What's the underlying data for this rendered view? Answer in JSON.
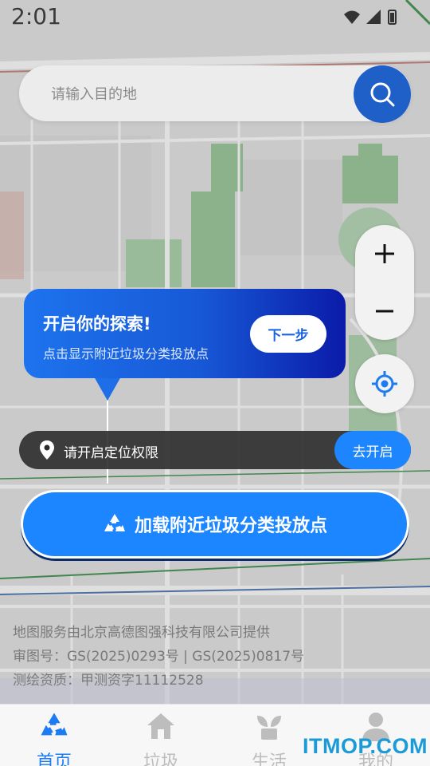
{
  "status_bar": {
    "time": "2:01"
  },
  "search": {
    "placeholder": "请输入目的地"
  },
  "guide_tooltip": {
    "title": "开启你的探索!",
    "subtitle": "点击显示附近垃圾分类投放点",
    "next_label": "下一步"
  },
  "location_banner": {
    "message": "请开启定位权限",
    "action_label": "去开启"
  },
  "main_action": {
    "label": "加载附近垃圾分类投放点"
  },
  "map_credits": {
    "line1": "地图服务由北京高德图强科技有限公司提供",
    "line2": "审图号：GS(2025)0293号 | GS(2025)0817号",
    "line3": "测绘资质：甲测资字11112528"
  },
  "tabs": [
    {
      "label": "首页",
      "icon": "recycle-icon",
      "active": true
    },
    {
      "label": "垃圾",
      "icon": "home-icon",
      "active": false
    },
    {
      "label": "生活",
      "icon": "plant-icon",
      "active": false
    },
    {
      "label": "我的",
      "icon": "user-icon",
      "active": false
    }
  ],
  "watermark": "ITMOP.COM",
  "colors": {
    "primary": "#1b86ff",
    "tooltip_start": "#1e73ee",
    "tooltip_end": "#0a1ba8",
    "tab_active": "#1d7cf2",
    "tab_inactive": "#bdbdbd"
  }
}
